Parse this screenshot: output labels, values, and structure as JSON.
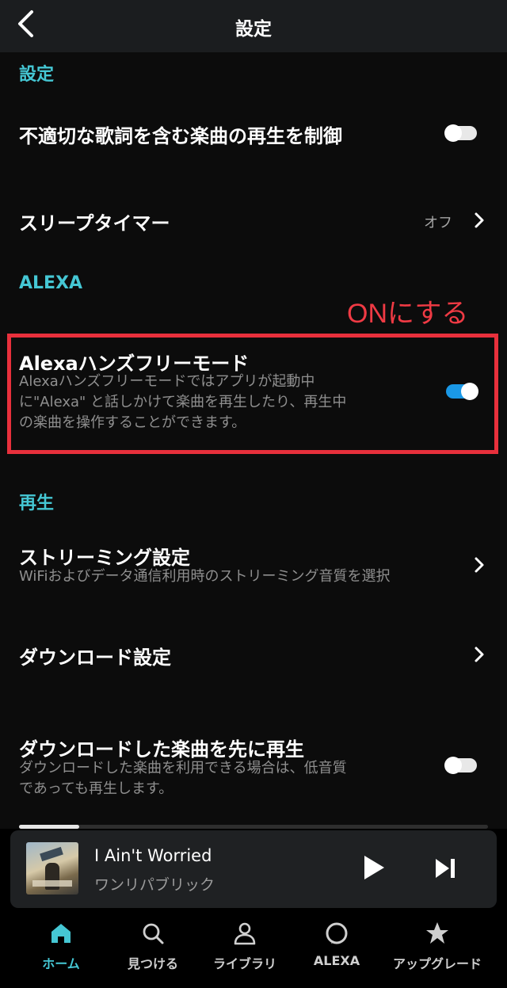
{
  "header": {
    "title": "設定",
    "back_icon": "chevron-left-icon"
  },
  "sections": {
    "settings": {
      "title": "設定",
      "explicit": {
        "label": "不適切な歌詞を含む楽曲の再生を制御",
        "toggle": "off"
      },
      "sleep_timer": {
        "label": "スリープタイマー",
        "value": "オフ"
      }
    },
    "alexa": {
      "title": "ALEXA",
      "hands_free": {
        "label": "Alexaハンズフリーモード",
        "description_lines": [
          "Alexaハンズフリーモードではアプリが起動中",
          "に\"Alexa\" と話しかけて楽曲を再生したり、再生中",
          "の楽曲を操作することができます。"
        ],
        "toggle": "on"
      }
    },
    "playback": {
      "title": "再生",
      "streaming": {
        "label": "ストリーミング設定",
        "description": "WiFiおよびデータ通信利用時のストリーミング音質を選択"
      },
      "download": {
        "label": "ダウンロード設定"
      },
      "downloaded_first": {
        "label": "ダウンロードした楽曲を先に再生",
        "description_lines": [
          "ダウンロードした楽曲を利用できる場合は、低音質",
          "であっても再生します。"
        ],
        "toggle": "off"
      }
    }
  },
  "annotation": {
    "text": "ONにする",
    "color": "#e8303c"
  },
  "now_playing": {
    "title": "I Ain't Worried",
    "artist": "ワンリパブリック",
    "play_icon": "play-icon",
    "next_icon": "skip-next-icon"
  },
  "nav": {
    "items": [
      {
        "label": "ホーム",
        "icon": "home-icon",
        "active": true
      },
      {
        "label": "見つける",
        "icon": "search-icon",
        "active": false
      },
      {
        "label": "ライブラリ",
        "icon": "person-icon",
        "active": false
      },
      {
        "label": "ALEXA",
        "icon": "alexa-ring-icon",
        "active": false
      },
      {
        "label": "アップグレード",
        "icon": "star-icon",
        "active": false
      }
    ]
  },
  "colors": {
    "accent": "#45c7d4",
    "toggle_on": "#1a98e6",
    "background": "#0c0c0c",
    "header": "#1b1d1f",
    "player": "#1f2123"
  }
}
